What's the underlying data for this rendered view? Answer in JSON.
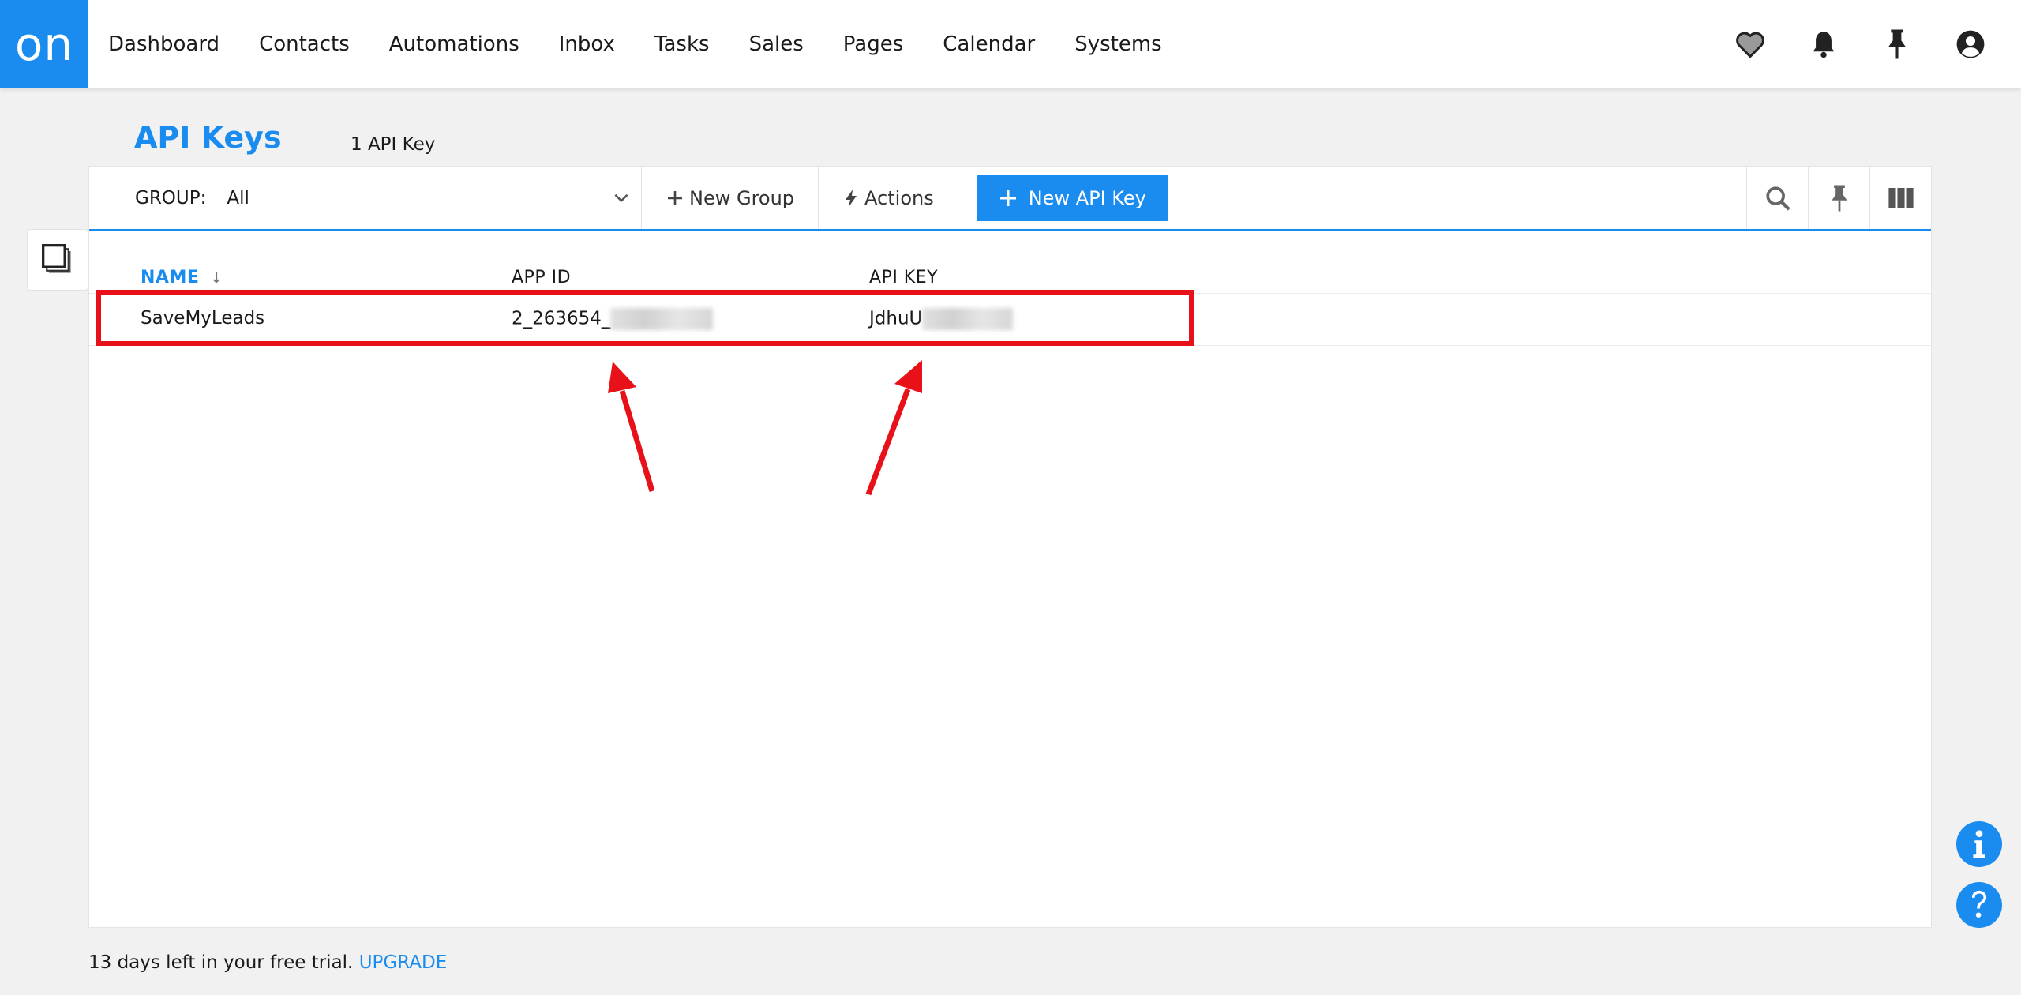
{
  "brand": {
    "logo_text": "on",
    "color": "#1a8cf0"
  },
  "nav": {
    "items": [
      "Dashboard",
      "Contacts",
      "Automations",
      "Inbox",
      "Tasks",
      "Sales",
      "Pages",
      "Calendar",
      "Systems"
    ]
  },
  "top_icons": [
    "heart-icon",
    "bell-icon",
    "pin-icon",
    "user-account-icon"
  ],
  "page": {
    "title": "API Keys",
    "count": "1 API Key"
  },
  "toolbar": {
    "group_label": "GROUP:",
    "group_value": "All",
    "new_group": "New Group",
    "actions": "Actions",
    "new_api_key": "New API Key"
  },
  "table": {
    "headers": {
      "name": "NAME",
      "app_id": "APP ID",
      "api_key": "API KEY"
    },
    "sort_indicator": "↓",
    "rows": [
      {
        "name": "SaveMyLeads",
        "app_id": "2_263654_",
        "api_key": "JdhuU"
      }
    ]
  },
  "trial": {
    "text": "13 days left in your free trial.",
    "upgrade": "UPGRADE"
  },
  "annotation_color": "#e8111a"
}
